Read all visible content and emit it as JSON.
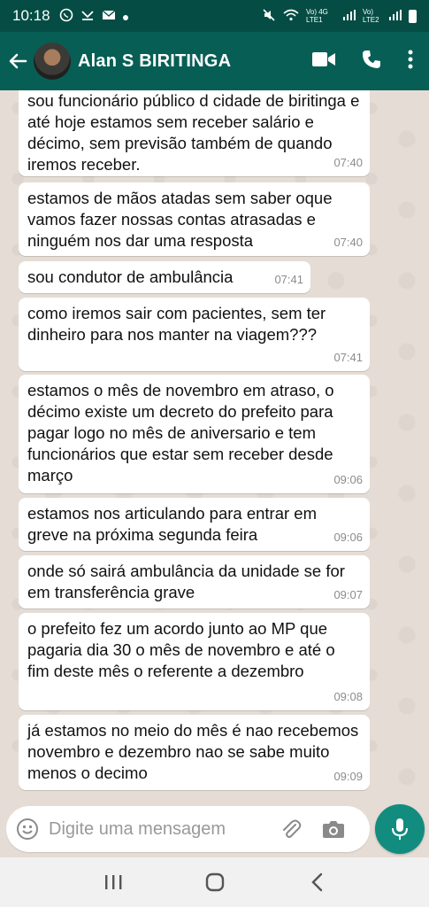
{
  "status_bar": {
    "time": "10:18",
    "network_label_1": "Vo) 4G LTE1",
    "network_label_2": "Vo) LTE2"
  },
  "header": {
    "contact_name": "Alan S BIRITINGA",
    "icons": [
      "back-arrow-icon",
      "video-call-icon",
      "phone-icon",
      "more-icon"
    ]
  },
  "messages": [
    {
      "text": "sou funcionário público d cidade de biritinga e até hoje estamos sem receber salário e décimo, sem previsão também de quando iremos receber.",
      "time": "07:40"
    },
    {
      "text": "estamos de mãos atadas sem saber oque vamos fazer nossas contas atrasadas e ninguém nos dar uma resposta",
      "time": "07:40"
    },
    {
      "text": "sou condutor de ambulância",
      "time": "07:41"
    },
    {
      "text": "como iremos sair com pacientes, sem ter dinheiro para nos manter na viagem???",
      "time": "07:41"
    },
    {
      "text": "estamos o mês de novembro em atraso, o décimo existe um decreto do prefeito para pagar logo no mês de aniversario e tem funcionários que estar sem receber desde março",
      "time": "09:06"
    },
    {
      "text": "estamos nos articulando para entrar em greve na próxima segunda feira",
      "time": "09:06"
    },
    {
      "text": "onde só sairá ambulância  da unidade se for em transferência grave",
      "time": "09:07"
    },
    {
      "text": "o prefeito fez um acordo junto ao MP que pagaria dia 30 o mês de novembro e até o fim deste mês o referente a dezembro",
      "time": "09:08"
    },
    {
      "text": "já estamos no meio do mês é nao recebemos novembro e dezembro nao se sabe muito menos o decimo",
      "time": "09:09"
    }
  ],
  "composer": {
    "placeholder": "Digite uma mensagem"
  },
  "colors": {
    "header": "#075e54",
    "status_bar": "#054d44",
    "chat_background": "#e5ddd5",
    "bubble": "#ffffff",
    "mic_button": "#128c7e"
  }
}
